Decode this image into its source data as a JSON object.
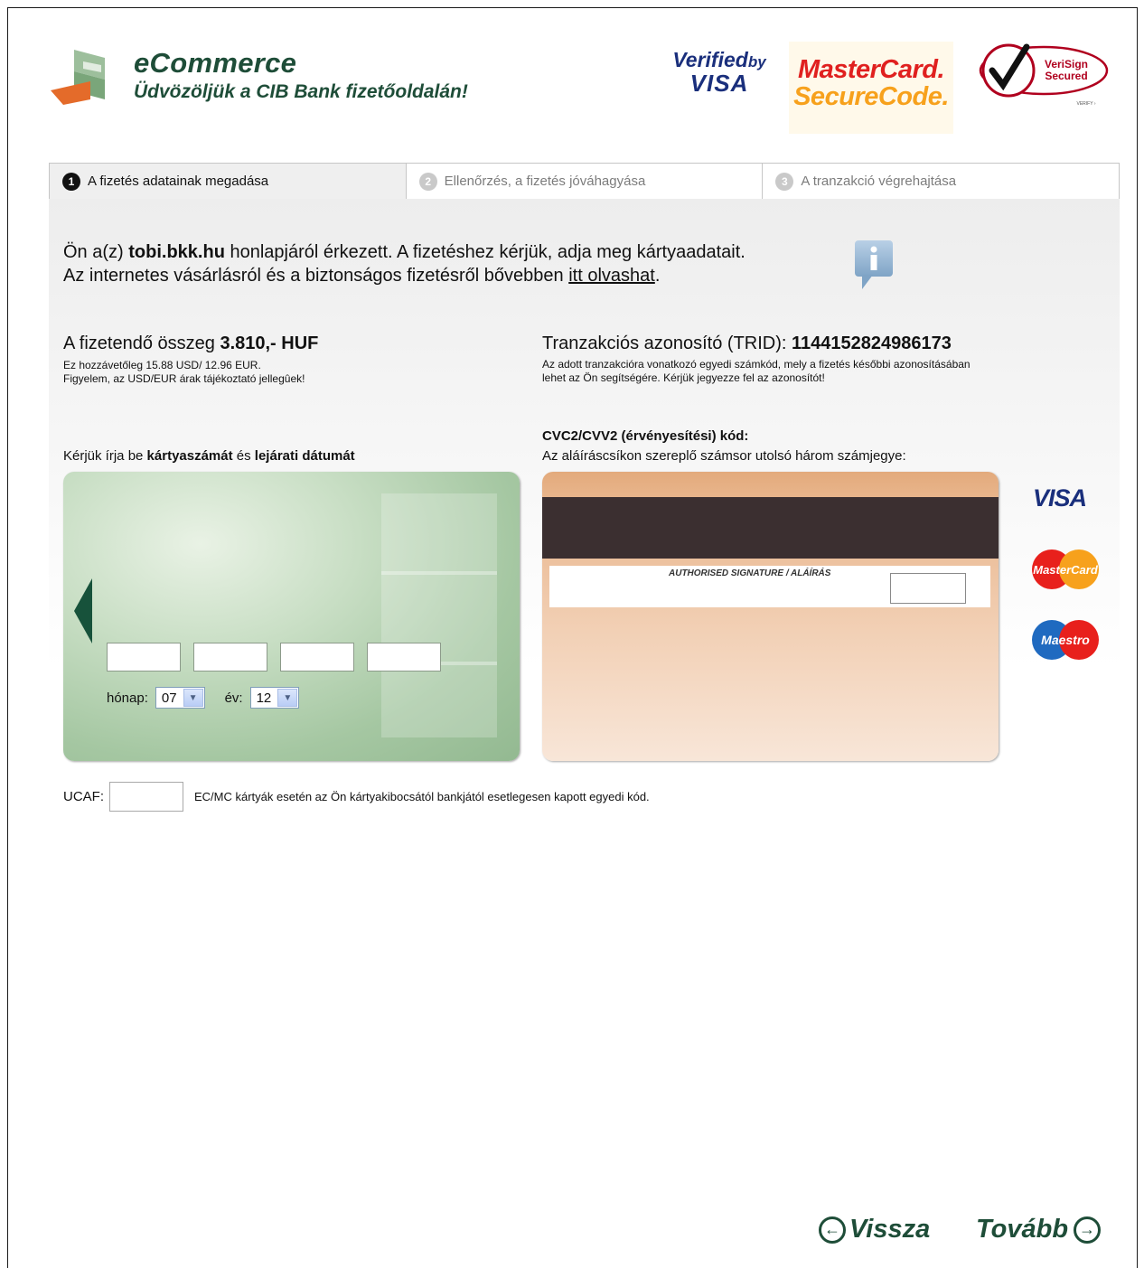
{
  "header": {
    "brand": "eCommerce",
    "welcome": "Üdvözöljük a CIB Bank fizetőoldalán!",
    "verified_visa_l1": "Verified",
    "verified_visa_by": "by",
    "verified_visa_l2": "VISA",
    "mc_securecode_l1": "MasterCard.",
    "mc_securecode_l2": "SecureCode.",
    "verisign_l1": "VeriSign",
    "verisign_l2": "Secured",
    "verisign_l3": "VERIFY ›"
  },
  "tabs": [
    {
      "num": "1",
      "label": "A fizetés adatainak megadása",
      "active": true
    },
    {
      "num": "2",
      "label": "Ellenőrzés, a fizetés jóváhagyása",
      "active": false
    },
    {
      "num": "3",
      "label": "A tranzakció végrehajtása",
      "active": false
    }
  ],
  "intro": {
    "prefix": "Ön a(z) ",
    "site": "tobi.bkk.hu",
    "suffix": "  honlapjáról érkezett. A fizetéshez kérjük, adja meg kártyaadatait.",
    "line2_prefix": "Az internetes vásárlásról és a biztonságos fizetésről bővebben ",
    "line2_link": "itt olvashat",
    "line2_suffix": "."
  },
  "amount": {
    "label": "A fizetendő összeg ",
    "value": "3.810,- HUF",
    "note1": "Ez hozzávetőleg 15.88 USD/ 12.96 EUR.",
    "note2": "Figyelem, az USD/EUR árak tájékoztató jellegûek!"
  },
  "trid": {
    "label": "Tranzakciós azonosító (TRID): ",
    "value": "1144152824986173",
    "note1": "Az adott tranzakcióra vonatkozó egyedi számkód, mely a fizetés későbbi azonosításában",
    "note2": "lehet az Ön segítségére. Kérjük jegyezze fel az azonosítót!"
  },
  "card_front": {
    "label_prefix": "Kérjük írja be ",
    "label_b1": "kártyaszámát",
    "label_mid": " és ",
    "label_b2": "lejárati dátumát",
    "month_label": "hónap:",
    "month_value": "07",
    "year_label": "év:",
    "year_value": "12"
  },
  "card_back": {
    "title": "CVC2/CVV2 (érvényesítési) kód:",
    "label": "Az aláíráscsíkon szereplő számsor utolsó három számjegye:",
    "signature_text": "AUTHORISED SIGNATURE / ALÁÍRÁS"
  },
  "brands": {
    "visa": "VISA",
    "mastercard": "MasterCard",
    "maestro": "Maestro"
  },
  "ucaf": {
    "label": "UCAF:",
    "description": "EC/MC kártyák esetén az Ön kártyakibocsától bankjától esetlegesen kapott egyedi kód."
  },
  "nav": {
    "back": "Vissza",
    "next": "Tovább"
  },
  "colors": {
    "brand_green": "#1e4d38",
    "visa_blue": "#1a2f7c",
    "mc_red": "#e0201f",
    "mc_orange": "#f7a11c"
  }
}
